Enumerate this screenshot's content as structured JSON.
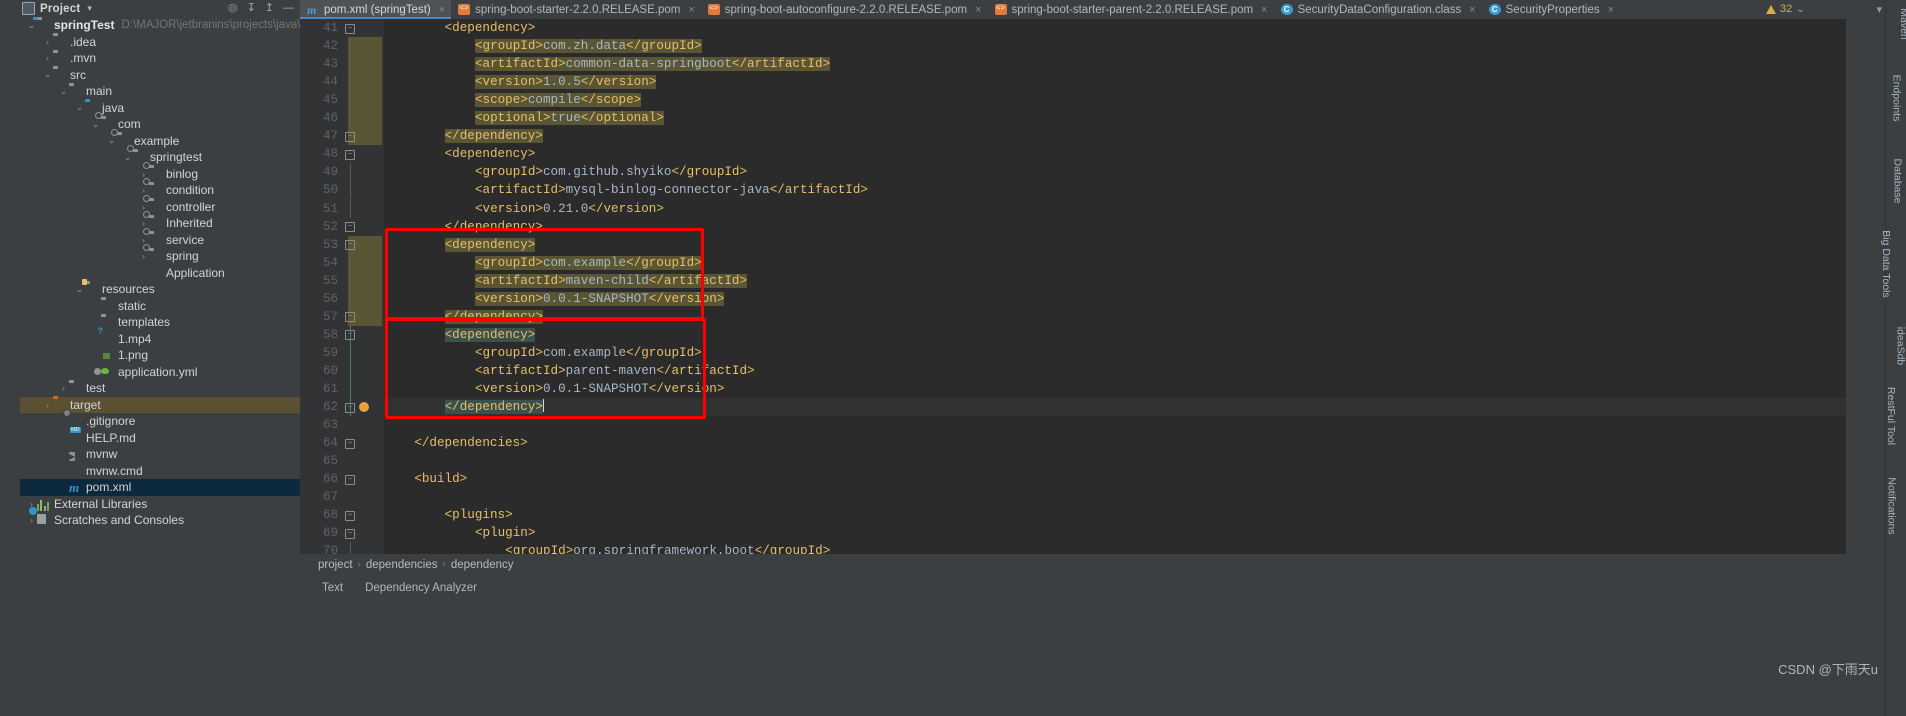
{
  "window": {
    "left_tool_labels": [
      "Project"
    ],
    "right_tool_labels": [
      "Maven",
      "Endpoints",
      "Database",
      "Big Data Tools",
      "ideaSdb",
      "RestFul Tool",
      "Notifications"
    ]
  },
  "project_panel": {
    "title": "Project",
    "title_chevron": "▾",
    "toolbar_icons": [
      "target-icon",
      "collapse-all-icon",
      "expand-all-icon",
      "hide-icon"
    ],
    "tree": [
      {
        "indent": 0,
        "arrow": "⌄",
        "icon": "module-folder-icon",
        "label": "springTest",
        "bold": true,
        "path": "D:\\MAJOR\\jetbranins\\projects\\java\\spring"
      },
      {
        "indent": 1,
        "arrow": "›",
        "icon": "folder-icon",
        "label": ".idea"
      },
      {
        "indent": 1,
        "arrow": "›",
        "icon": "folder-icon",
        "label": ".mvn"
      },
      {
        "indent": 1,
        "arrow": "⌄",
        "icon": "folder-icon",
        "label": "src"
      },
      {
        "indent": 2,
        "arrow": "⌄",
        "icon": "folder-icon",
        "label": "main"
      },
      {
        "indent": 3,
        "arrow": "⌄",
        "icon": "source-root-icon",
        "label": "java"
      },
      {
        "indent": 4,
        "arrow": "⌄",
        "icon": "package-icon",
        "label": "com"
      },
      {
        "indent": 5,
        "arrow": "⌄",
        "icon": "package-icon",
        "label": "example"
      },
      {
        "indent": 6,
        "arrow": "⌄",
        "icon": "package-icon",
        "label": "springtest"
      },
      {
        "indent": 7,
        "arrow": "›",
        "icon": "package-icon",
        "label": "binlog"
      },
      {
        "indent": 7,
        "arrow": "›",
        "icon": "package-icon",
        "label": "condition"
      },
      {
        "indent": 7,
        "arrow": "›",
        "icon": "package-icon",
        "label": "controller"
      },
      {
        "indent": 7,
        "arrow": "›",
        "icon": "package-icon",
        "label": "Inherited"
      },
      {
        "indent": 7,
        "arrow": "›",
        "icon": "package-icon",
        "label": "service"
      },
      {
        "indent": 7,
        "arrow": "›",
        "icon": "package-icon",
        "label": "spring"
      },
      {
        "indent": 7,
        "arrow": "",
        "icon": "spring-boot-class-icon",
        "label": "Application"
      },
      {
        "indent": 3,
        "arrow": "⌄",
        "icon": "resources-folder-icon",
        "label": "resources"
      },
      {
        "indent": 4,
        "arrow": "",
        "icon": "folder-icon",
        "label": "static"
      },
      {
        "indent": 4,
        "arrow": "",
        "icon": "folder-icon",
        "label": "templates"
      },
      {
        "indent": 4,
        "arrow": "",
        "icon": "media-file-icon",
        "label": "1.mp4"
      },
      {
        "indent": 4,
        "arrow": "",
        "icon": "image-file-icon",
        "label": "1.png"
      },
      {
        "indent": 4,
        "arrow": "",
        "icon": "yaml-file-icon",
        "label": "application.yml"
      },
      {
        "indent": 2,
        "arrow": "›",
        "icon": "folder-icon",
        "label": "test"
      },
      {
        "indent": 1,
        "arrow": "›",
        "icon": "excluded-folder-icon",
        "label": "target",
        "state": "selected-inactive"
      },
      {
        "indent": 2,
        "arrow": "",
        "icon": "gitignore-file-icon",
        "label": ".gitignore"
      },
      {
        "indent": 2,
        "arrow": "",
        "icon": "markdown-file-icon",
        "label": "HELP.md"
      },
      {
        "indent": 2,
        "arrow": "",
        "icon": "shell-script-icon",
        "label": "mvnw"
      },
      {
        "indent": 2,
        "arrow": "",
        "icon": "cmd-file-icon",
        "label": "mvnw.cmd"
      },
      {
        "indent": 2,
        "arrow": "",
        "icon": "maven-pom-icon",
        "label": "pom.xml",
        "state": "selected"
      },
      {
        "indent": 0,
        "arrow": "›",
        "icon": "external-libraries-icon",
        "label": "External Libraries"
      },
      {
        "indent": 0,
        "arrow": "›",
        "icon": "scratches-icon",
        "label": "Scratches and Consoles"
      }
    ]
  },
  "tabs": {
    "items": [
      {
        "label": "pom.xml (springTest)",
        "icon": "maven-pom-icon",
        "active": true,
        "close": "×"
      },
      {
        "label": "spring-boot-starter-2.2.0.RELEASE.pom",
        "icon": "pom-file-icon",
        "active": false,
        "close": "×"
      },
      {
        "label": "spring-boot-autoconfigure-2.2.0.RELEASE.pom",
        "icon": "pom-file-icon",
        "active": false,
        "close": "×"
      },
      {
        "label": "spring-boot-starter-parent-2.2.0.RELEASE.pom",
        "icon": "pom-file-icon",
        "active": false,
        "close": "×"
      },
      {
        "label": "SecurityDataConfiguration.class",
        "icon": "class-file-icon",
        "active": false,
        "close": "×"
      },
      {
        "label": "SecurityProperties",
        "icon": "class-file-icon",
        "active": false,
        "close": "×"
      }
    ],
    "overflow_chevron": "▾",
    "more_menu": "⋮"
  },
  "inspection_widget": {
    "count": "32",
    "chevron": "⌄"
  },
  "editor": {
    "first_line": 41,
    "lines": [
      {
        "n": 41,
        "indent": "        ",
        "text": "<dependency>",
        "kind": "tag",
        "fold": "collapse"
      },
      {
        "n": 42,
        "indent": "            ",
        "text": "<groupId>com.zh.data</groupId>",
        "kind": "pair",
        "highlight": "olive"
      },
      {
        "n": 43,
        "indent": "            ",
        "text": "<artifactId>common-data-springboot</artifactId>",
        "kind": "pair",
        "highlight": "olive"
      },
      {
        "n": 44,
        "indent": "            ",
        "text": "<version>1.0.5</version>",
        "kind": "pair",
        "highlight": "olive"
      },
      {
        "n": 45,
        "indent": "            ",
        "text": "<scope>compile</scope>",
        "kind": "pair",
        "highlight": "olive"
      },
      {
        "n": 46,
        "indent": "            ",
        "text": "<optional>true</optional>",
        "kind": "pair",
        "highlight": "olive"
      },
      {
        "n": 47,
        "indent": "        ",
        "text": "</dependency>",
        "kind": "tag",
        "fold": "collapse",
        "highlight": "olive"
      },
      {
        "n": 48,
        "indent": "        ",
        "text": "<dependency>",
        "kind": "tag",
        "fold": "collapse"
      },
      {
        "n": 49,
        "indent": "            ",
        "text": "<groupId>com.github.shyiko</groupId>",
        "kind": "pair"
      },
      {
        "n": 50,
        "indent": "            ",
        "text": "<artifactId>mysql-binlog-connector-java</artifactId>",
        "kind": "pair"
      },
      {
        "n": 51,
        "indent": "            ",
        "text": "<version>0.21.0</version>",
        "kind": "pair"
      },
      {
        "n": 52,
        "indent": "        ",
        "text": "</dependency>",
        "kind": "tag",
        "fold": "collapse"
      },
      {
        "n": 53,
        "indent": "        ",
        "text": "<dependency>",
        "kind": "tag",
        "fold": "collapse",
        "highlight": "olive"
      },
      {
        "n": 54,
        "indent": "            ",
        "text": "<groupId>com.example</groupId>",
        "kind": "pair",
        "highlight": "olive"
      },
      {
        "n": 55,
        "indent": "            ",
        "text": "<artifactId>maven-child</artifactId>",
        "kind": "pair",
        "highlight": "olive"
      },
      {
        "n": 56,
        "indent": "            ",
        "text": "<version>0.0.1-SNAPSHOT</version>",
        "kind": "pair",
        "highlight": "olive"
      },
      {
        "n": 57,
        "indent": "        ",
        "text": "</dependency>",
        "kind": "tag",
        "fold": "collapse",
        "highlight": "olive"
      },
      {
        "n": 58,
        "indent": "        ",
        "text": "<dependency>",
        "kind": "tag",
        "fold": "collapse",
        "highlight": "teal"
      },
      {
        "n": 59,
        "indent": "            ",
        "text": "<groupId>com.example</groupId>",
        "kind": "pair"
      },
      {
        "n": 60,
        "indent": "            ",
        "text": "<artifactId>parent-maven</artifactId>",
        "kind": "pair"
      },
      {
        "n": 61,
        "indent": "            ",
        "text": "<version>0.0.1-SNAPSHOT</version>",
        "kind": "pair"
      },
      {
        "n": 62,
        "indent": "        ",
        "text": "</dependency>",
        "kind": "tag",
        "fold": "collapse",
        "highlight": "teal",
        "caret": true,
        "bulb": true,
        "current": true
      },
      {
        "n": 63,
        "indent": "",
        "text": "",
        "kind": "blank"
      },
      {
        "n": 64,
        "indent": "    ",
        "text": "</dependencies>",
        "kind": "tag",
        "fold": "collapse"
      },
      {
        "n": 65,
        "indent": "",
        "text": "",
        "kind": "blank"
      },
      {
        "n": 66,
        "indent": "    ",
        "text": "<build>",
        "kind": "tag",
        "fold": "collapse"
      },
      {
        "n": 67,
        "indent": "",
        "text": "",
        "kind": "blank"
      },
      {
        "n": 68,
        "indent": "        ",
        "text": "<plugins>",
        "kind": "tag",
        "fold": "collapse"
      },
      {
        "n": 69,
        "indent": "            ",
        "text": "<plugin>",
        "kind": "tag",
        "fold": "collapse"
      },
      {
        "n": 70,
        "indent": "                ",
        "text": "<groupId>org.springframework.boot</groupId>",
        "kind": "pair"
      }
    ],
    "annotations": [
      {
        "name": "maven-child-dependency-highlight",
        "label": ""
      },
      {
        "name": "parent-maven-dependency-highlight",
        "label": ""
      }
    ]
  },
  "breadcrumb": {
    "items": [
      "project",
      "dependencies",
      "dependency"
    ],
    "separator": "›"
  },
  "bottom_bar": {
    "items": [
      "Text",
      "Dependency Analyzer"
    ]
  },
  "watermark": "CSDN @下雨天u",
  "colors": {
    "accent": "#4a88c7",
    "annotation_red": "#ff0000",
    "editor_bg": "#2b2b2b",
    "panel_bg": "#3c3f41",
    "tag": "#e8bf6a",
    "text": "#a9b7c6",
    "olive_highlight": "#5a5633",
    "teal_selection": "#3b514d"
  }
}
